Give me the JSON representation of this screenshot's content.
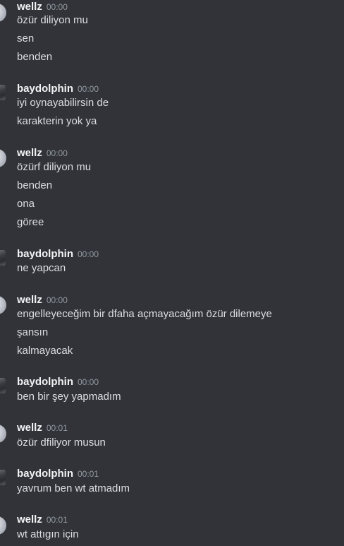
{
  "messages": [
    {
      "author": "wellz",
      "time": "00:00",
      "lines": [
        "özür diliyon mu",
        "sen",
        "benden"
      ]
    },
    {
      "author": "baydolphin",
      "time": "00:00",
      "lines": [
        "iyi oynayabilirsin de",
        "karakterin yok ya"
      ]
    },
    {
      "author": "wellz",
      "time": "00:00",
      "lines": [
        "özürf diliyon mu",
        "benden",
        "ona",
        "göree"
      ]
    },
    {
      "author": "baydolphin",
      "time": "00:00",
      "lines": [
        "ne yapcan"
      ]
    },
    {
      "author": "wellz",
      "time": "00:00",
      "lines": [
        "engelleyeceğim bir dfaha açmayacağım özür dilemeye",
        "şansın",
        "kalmayacak"
      ]
    },
    {
      "author": "baydolphin",
      "time": "00:00",
      "lines": [
        "ben bir şey yapmadım"
      ]
    },
    {
      "author": "wellz",
      "time": "00:01",
      "lines": [
        "özür dfiliyor musun"
      ]
    },
    {
      "author": "baydolphin",
      "time": "00:01",
      "lines": [
        "yavrum ben wt atmadım"
      ]
    },
    {
      "author": "wellz",
      "time": "00:01",
      "lines": [
        "wt attıgın için"
      ]
    }
  ]
}
